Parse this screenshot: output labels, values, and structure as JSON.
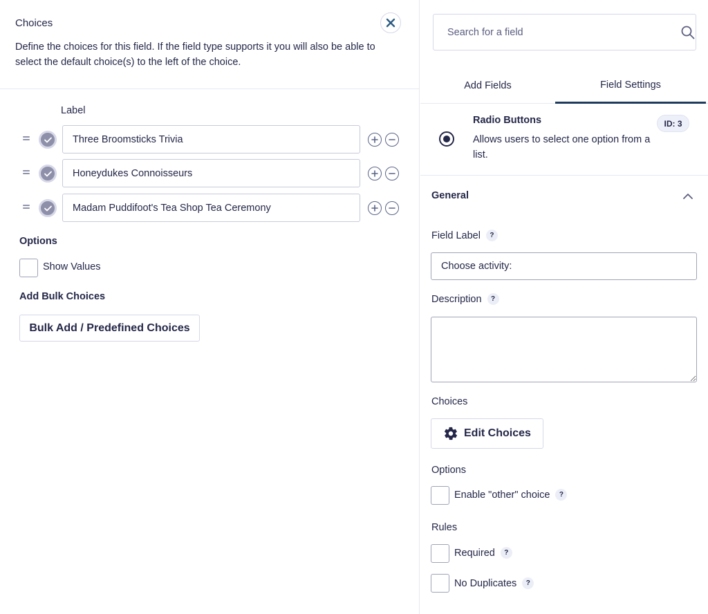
{
  "choices_editor": {
    "title": "Choices",
    "description": "Define the choices for this field. If the field type supports it you will also be able to select the default choice(s) to the left of the choice.",
    "label_header": "Label",
    "items": [
      {
        "label": "Three Broomsticks Trivia"
      },
      {
        "label": "Honeydukes Connoisseurs"
      },
      {
        "label": "Madam Puddifoot's Tea Shop Tea Ceremony"
      }
    ],
    "options_heading": "Options",
    "show_values_label": "Show Values",
    "bulk_heading": "Add Bulk Choices",
    "bulk_button_label": "Bulk Add / Predefined Choices"
  },
  "sidebar": {
    "search": {
      "placeholder": "Search for a field",
      "value": ""
    },
    "tabs": [
      {
        "label": "Add Fields",
        "active": false
      },
      {
        "label": "Field Settings",
        "active": true
      }
    ],
    "field_type": {
      "name": "Radio Buttons",
      "description": "Allows users to select one option from a list.",
      "id_badge": "ID: 3"
    },
    "general": {
      "title": "General",
      "field_label": {
        "label": "Field Label",
        "help": "?",
        "value": "Choose activity:"
      },
      "description": {
        "label": "Description",
        "help": "?",
        "value": ""
      },
      "choices": {
        "label": "Choices",
        "button": "Edit Choices"
      },
      "options": {
        "label": "Options",
        "enable_other": "Enable \"other\" choice",
        "help": "?"
      },
      "rules": {
        "label": "Rules",
        "required": "Required",
        "required_help": "?",
        "no_duplicates": "No Duplicates",
        "no_duplicates_help": "?"
      }
    }
  },
  "colors": {
    "text": "#242748",
    "accent": "#1e3b5e",
    "check": "#8e8fa9",
    "border": "#d5d7e9"
  }
}
